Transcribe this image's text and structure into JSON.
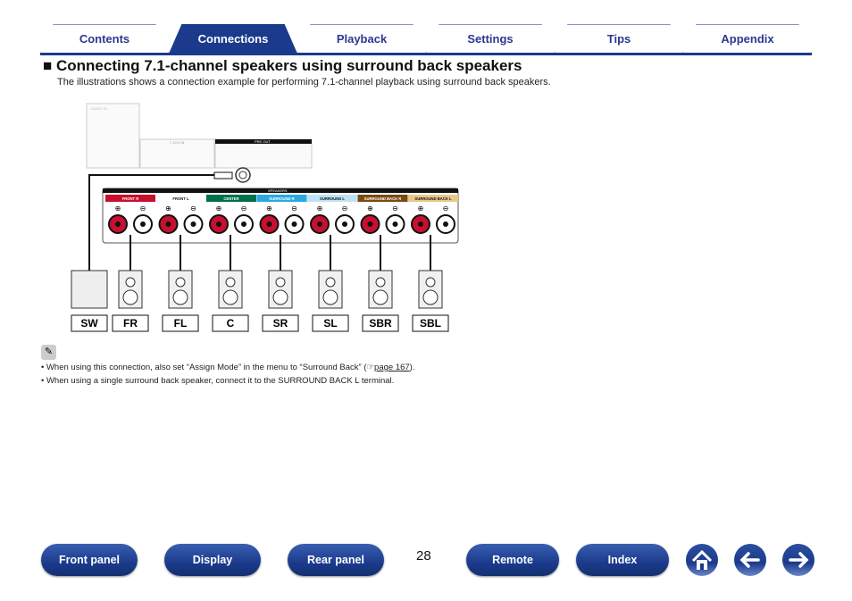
{
  "tabs": [
    {
      "label": "Contents"
    },
    {
      "label": "Connections",
      "active": true
    },
    {
      "label": "Playback"
    },
    {
      "label": "Settings"
    },
    {
      "label": "Tips"
    },
    {
      "label": "Appendix"
    }
  ],
  "title": "■ Connecting 7.1-channel speakers using surround back speakers",
  "subtitle": "The illustrations shows a connection example for performing 7.1-channel playback using surround back speakers.",
  "diagram": {
    "panel_labels": {
      "speakers": "SPEAKERS",
      "preout": "PRE OUT",
      "audio_in": "AUDIO IN",
      "ch71_in": "7.1CH IN"
    },
    "terminals": [
      {
        "label": "FRONT R",
        "color": "#c8102e",
        "text": "#ffffff"
      },
      {
        "label": "FRONT L",
        "color": "#ffffff",
        "text": "#111111"
      },
      {
        "label": "CENTER",
        "color": "#00704a",
        "text": "#ffffff"
      },
      {
        "label": "SURROUND R",
        "color": "#29a9e0",
        "text": "#ffffff"
      },
      {
        "label": "SURROUND L",
        "color": "#bfe3f5",
        "text": "#111111"
      },
      {
        "label": "SURROUND BACK R",
        "color": "#7a4a10",
        "text": "#ffffff"
      },
      {
        "label": "SURROUND BACK L",
        "color": "#e8c98a",
        "text": "#111111"
      }
    ],
    "speakers": [
      "SW",
      "FR",
      "FL",
      "C",
      "SR",
      "SL",
      "SBR",
      "SBL"
    ]
  },
  "notes": {
    "icon": "pencil-icon",
    "items": [
      {
        "text": "• When using this connection, also set “Assign Mode” in the menu to “Surround Back” (",
        "link": "page 167",
        "tail": ")."
      },
      {
        "text": "• When using a single surround back speaker, connect it to the SURROUND BACK L terminal."
      }
    ]
  },
  "footer": {
    "page_number": "28",
    "buttons": [
      "Front panel",
      "Display",
      "Rear panel",
      "Remote",
      "Index"
    ],
    "icons": [
      "home-icon",
      "back-arrow-icon",
      "forward-arrow-icon"
    ]
  }
}
